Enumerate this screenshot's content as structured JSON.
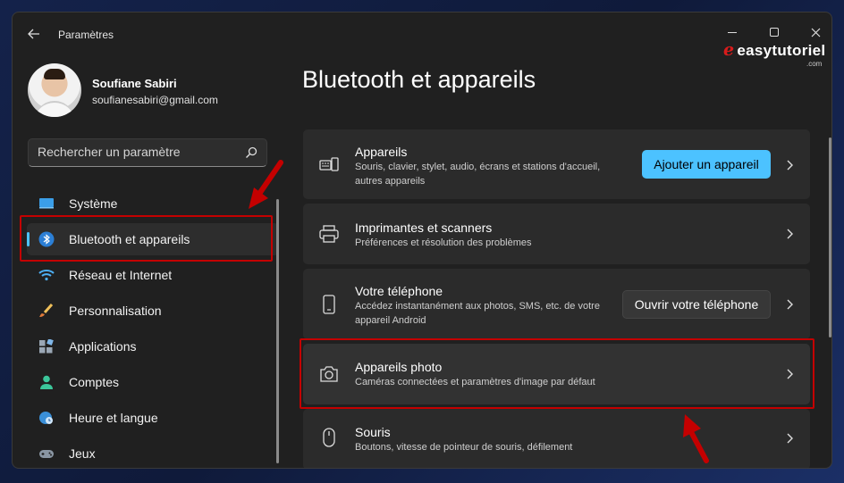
{
  "window": {
    "title": "Paramètres",
    "controls": {
      "minimize": "minimize-icon",
      "maximize": "maximize-icon",
      "close": "close-icon"
    },
    "watermark": {
      "brand": "easytutoriel",
      "sub": ".com"
    }
  },
  "profile": {
    "name": "Soufiane Sabiri",
    "email": "soufianesabiri@gmail.com"
  },
  "search": {
    "placeholder": "Rechercher un paramètre",
    "icon": "search-icon"
  },
  "sidebar": {
    "items": [
      {
        "label": "Système",
        "icon": "monitor-icon",
        "active": false
      },
      {
        "label": "Bluetooth et appareils",
        "icon": "bluetooth-icon",
        "active": true
      },
      {
        "label": "Réseau et Internet",
        "icon": "wifi-icon",
        "active": false
      },
      {
        "label": "Personnalisation",
        "icon": "brush-icon",
        "active": false
      },
      {
        "label": "Applications",
        "icon": "apps-icon",
        "active": false
      },
      {
        "label": "Comptes",
        "icon": "person-icon",
        "active": false
      },
      {
        "label": "Heure et langue",
        "icon": "globe-clock-icon",
        "active": false
      },
      {
        "label": "Jeux",
        "icon": "gamepad-icon",
        "active": false
      }
    ]
  },
  "main": {
    "title": "Bluetooth et appareils",
    "cards": [
      {
        "title": "Appareils",
        "desc": "Souris, clavier, stylet, audio, écrans et stations d'accueil, autres appareils",
        "button": "Ajouter un appareil",
        "icon": "devices-icon"
      },
      {
        "title": "Imprimantes et scanners",
        "desc": "Préférences et résolution des problèmes",
        "icon": "printer-icon"
      },
      {
        "title": "Votre téléphone",
        "desc": "Accédez instantanément aux photos, SMS, etc. de votre appareil Android",
        "button": "Ouvrir votre téléphone",
        "icon": "phone-icon"
      },
      {
        "title": "Appareils photo",
        "desc": "Caméras connectées et paramètres d'image par défaut",
        "icon": "camera-icon"
      },
      {
        "title": "Souris",
        "desc": "Boutons, vitesse de pointeur de souris, défilement",
        "icon": "mouse-icon"
      }
    ]
  },
  "colors": {
    "accent": "#4cc2ff",
    "window_bg": "#202020",
    "card_bg": "#2b2b2b",
    "annotation_red": "#c40000"
  }
}
